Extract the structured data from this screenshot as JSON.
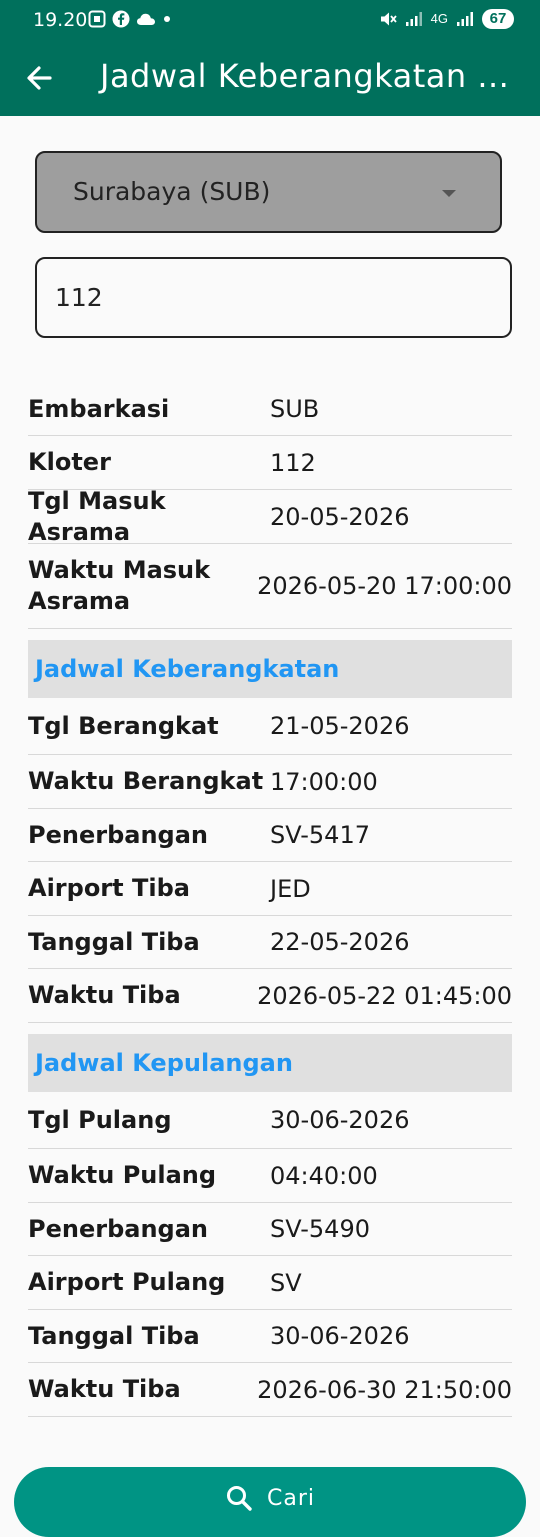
{
  "status_bar": {
    "time": "19.20",
    "left_icons": [
      "screenshot-icon",
      "facebook-icon",
      "cloud-icon",
      "dot-icon"
    ],
    "network_label": "4G",
    "battery": "67"
  },
  "app_bar": {
    "title": "Jadwal Keberangkatan ..."
  },
  "form": {
    "embarkasi_selected": "Surabaya (SUB)",
    "kloter_value": "112"
  },
  "info_rows": [
    {
      "label": "Embarkasi",
      "value": "SUB"
    },
    {
      "label": "Kloter",
      "value": "112"
    },
    {
      "label": "Tgl Masuk Asrama",
      "value": "20-05-2026"
    },
    {
      "label": "Waktu Masuk Asrama",
      "value": "2026-05-20 17:00:00"
    }
  ],
  "departure": {
    "heading": "Jadwal Keberangkatan",
    "rows": [
      {
        "label": "Tgl Berangkat",
        "value": "21-05-2026"
      },
      {
        "label": "Waktu Berangkat",
        "value": "17:00:00"
      },
      {
        "label": "Penerbangan",
        "value": "SV-5417"
      },
      {
        "label": "Airport Tiba",
        "value": "JED"
      },
      {
        "label": "Tanggal Tiba",
        "value": "22-05-2026"
      },
      {
        "label": "Waktu Tiba",
        "value": "2026-05-22 01:45:00"
      }
    ]
  },
  "return": {
    "heading": "Jadwal Kepulangan",
    "rows": [
      {
        "label": "Tgl Pulang",
        "value": "30-06-2026"
      },
      {
        "label": "Waktu Pulang",
        "value": "04:40:00"
      },
      {
        "label": "Penerbangan",
        "value": "SV-5490"
      },
      {
        "label": "Airport Pulang",
        "value": "SV"
      },
      {
        "label": "Tanggal Tiba",
        "value": "30-06-2026"
      },
      {
        "label": "Waktu Tiba",
        "value": "2026-06-30 21:50:00"
      }
    ]
  },
  "search_button": {
    "label": "Cari",
    "icon": "search-icon"
  },
  "colors": {
    "primary": "#00705c",
    "button": "#009484",
    "section_heading": "#2196f3"
  }
}
